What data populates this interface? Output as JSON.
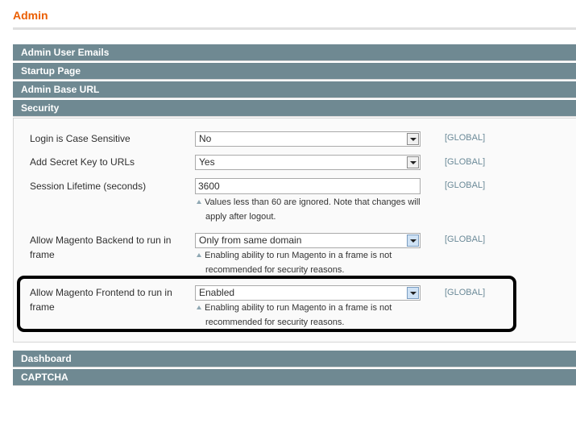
{
  "page": {
    "title": "Admin"
  },
  "sections": {
    "admin_user_emails": "Admin User Emails",
    "startup_page": "Startup Page",
    "admin_base_url": "Admin Base URL",
    "security": "Security",
    "dashboard": "Dashboard",
    "captcha": "CAPTCHA"
  },
  "security": {
    "login_case": {
      "label": "Login is Case Sensitive",
      "value": "No",
      "scope": "[GLOBAL]"
    },
    "secret_key": {
      "label": "Add Secret Key to URLs",
      "value": "Yes",
      "scope": "[GLOBAL]"
    },
    "session_lifetime": {
      "label": "Session Lifetime (seconds)",
      "value": "3600",
      "scope": "[GLOBAL]",
      "note_line1": "Values less than 60 are ignored. Note that changes will",
      "note_line2": "apply after logout."
    },
    "backend_frame": {
      "label_line1": "Allow Magento Backend to run in",
      "label_line2": "frame",
      "value": "Only from same domain",
      "scope": "[GLOBAL]",
      "note_line1": "Enabling ability to run Magento in a frame is not",
      "note_line2": "recommended for security reasons."
    },
    "frontend_frame": {
      "label_line1": "Allow Magento Frontend to run in",
      "label_line2": "frame",
      "value": "Enabled",
      "scope": "[GLOBAL]",
      "note_line1": "Enabling ability to run Magento in a frame is not",
      "note_line2": "recommended for security reasons."
    }
  },
  "colors": {
    "title": "#eb5e00",
    "section_header": "#6f8992",
    "scope_text": "#6b8a98",
    "highlight_border": "#000000"
  },
  "icons": {
    "select_arrow": "chevron-down-icon",
    "note_marker": "triangle-up-icon"
  }
}
